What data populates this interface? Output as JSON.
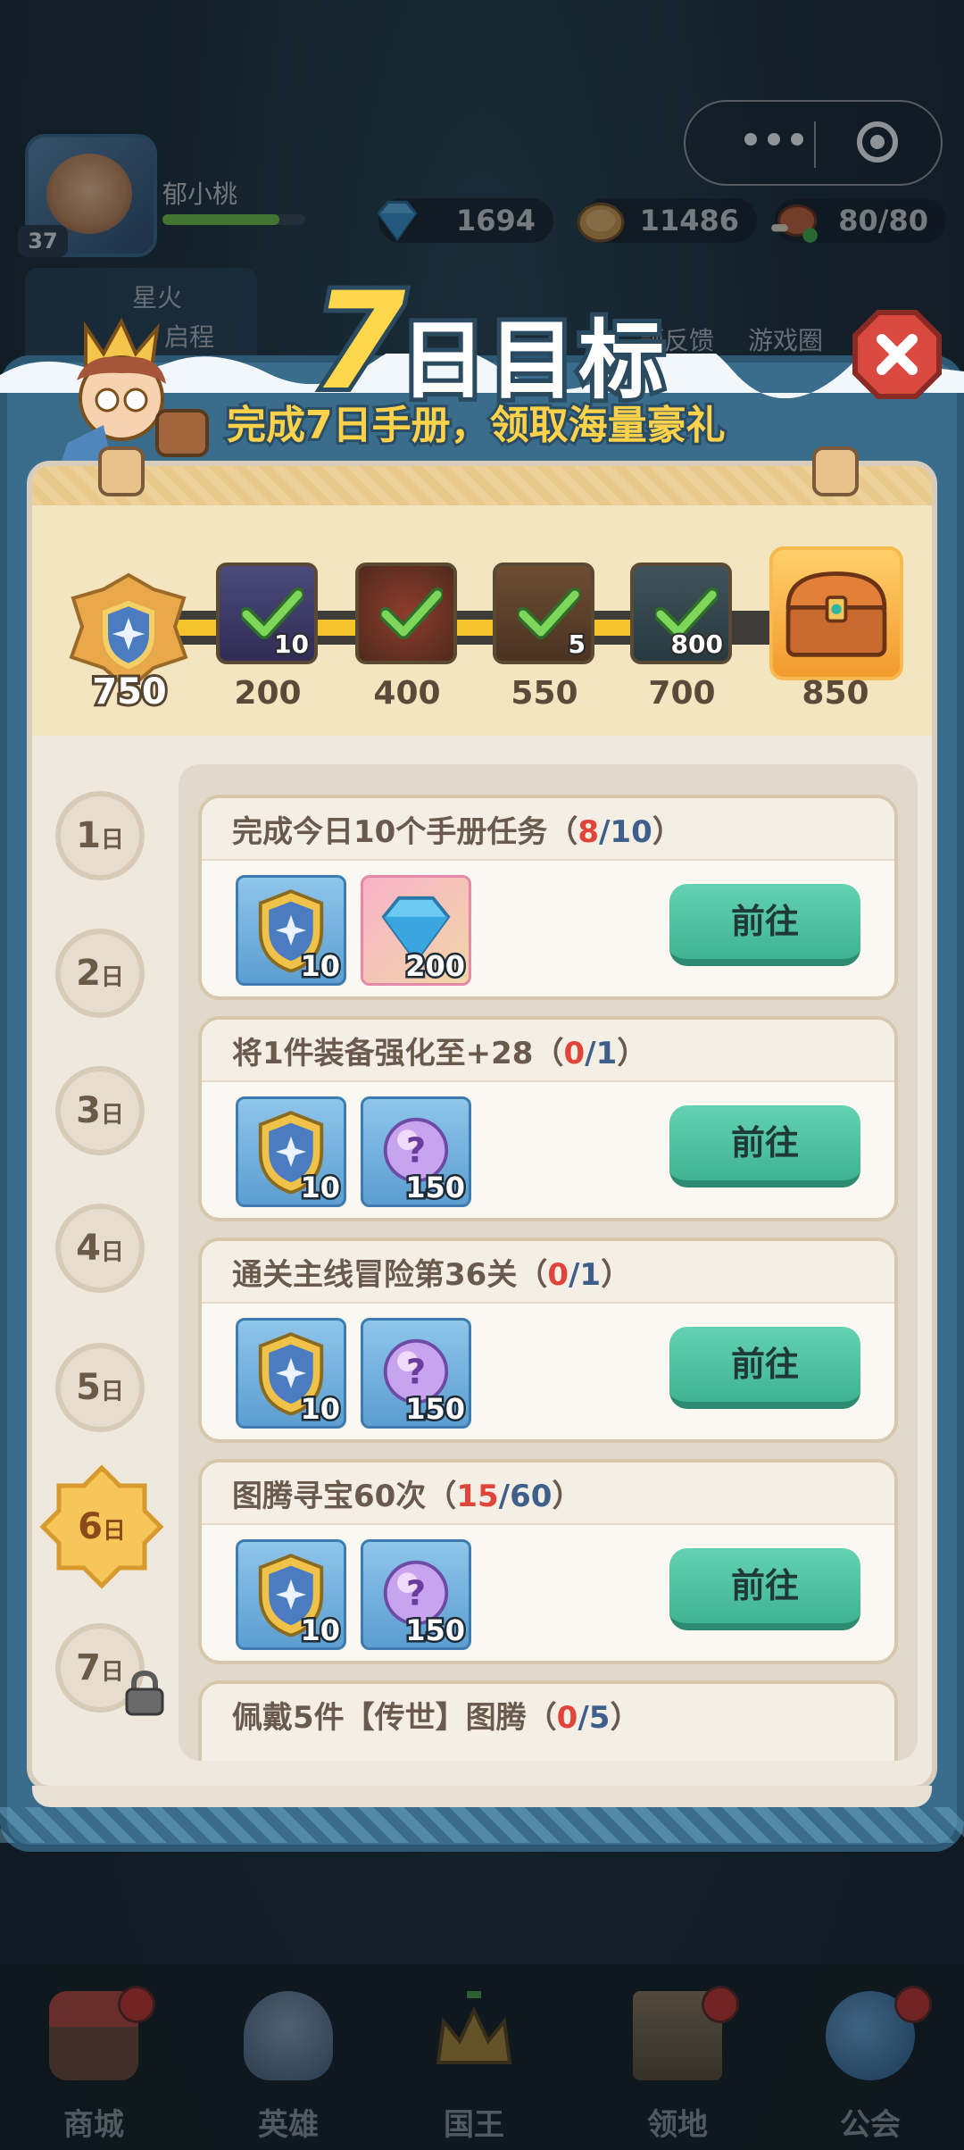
{
  "hud": {
    "player_name": "郁小桃",
    "level": "37",
    "xp_fraction": 0.82,
    "resources": [
      {
        "name": "diamond",
        "icon": "diamond-icon",
        "value": "1694"
      },
      {
        "name": "coin",
        "icon": "coin-icon",
        "value": "11486"
      },
      {
        "name": "stamina",
        "icon": "meat-icon",
        "value": "80/80"
      }
    ],
    "behind_buttons": [
      "星火",
      "启程",
      "题反馈",
      "游戏圈"
    ]
  },
  "modal": {
    "title_number": "7",
    "title_text": "日目标",
    "subtitle": "完成7日手册，领取海量豪礼",
    "points": "750",
    "progress_fraction": 0.78,
    "milestones": [
      {
        "threshold": "200",
        "count": "10",
        "icon": "book-icon",
        "claimed": true
      },
      {
        "threshold": "400",
        "count": "",
        "icon": "shield-orb-icon",
        "claimed": true
      },
      {
        "threshold": "550",
        "count": "5",
        "icon": "hammer-icon",
        "claimed": true
      },
      {
        "threshold": "700",
        "count": "800",
        "icon": "gem-icon",
        "claimed": true
      },
      {
        "threshold": "850",
        "count": "",
        "icon": "treasure-chest-icon",
        "claimed": false
      }
    ],
    "days": [
      {
        "num": "1",
        "suffix": "日"
      },
      {
        "num": "2",
        "suffix": "日"
      },
      {
        "num": "3",
        "suffix": "日"
      },
      {
        "num": "4",
        "suffix": "日"
      },
      {
        "num": "5",
        "suffix": "日"
      },
      {
        "num": "6",
        "suffix": "日"
      },
      {
        "num": "7",
        "suffix": "日"
      }
    ],
    "active_day_index": 5,
    "tasks": [
      {
        "title": "完成今日10个手册任务（",
        "progress": "8",
        "sep": "/",
        "total": "10",
        "close": "）",
        "rewards": [
          {
            "icon": "shield-token-icon",
            "count": "10"
          },
          {
            "icon": "diamond-icon",
            "count": "200"
          }
        ],
        "button": "前往"
      },
      {
        "title": "将1件装备强化至+28（",
        "progress": "0",
        "sep": "/",
        "total": "1",
        "close": "）",
        "rewards": [
          {
            "icon": "shield-token-icon",
            "count": "10"
          },
          {
            "icon": "mystery-orb-icon",
            "count": "150"
          }
        ],
        "button": "前往"
      },
      {
        "title": "通关主线冒险第36关（",
        "progress": "0",
        "sep": "/",
        "total": "1",
        "close": "）",
        "rewards": [
          {
            "icon": "shield-token-icon",
            "count": "10"
          },
          {
            "icon": "mystery-orb-icon",
            "count": "150"
          }
        ],
        "button": "前往"
      },
      {
        "title": "图腾寻宝60次（",
        "progress": "15",
        "sep": "/",
        "total": "60",
        "close": "）",
        "rewards": [
          {
            "icon": "shield-token-icon",
            "count": "10"
          },
          {
            "icon": "mystery-orb-icon",
            "count": "150"
          }
        ],
        "button": "前往"
      },
      {
        "title": "佩戴5件【传世】图腾（",
        "progress": "0",
        "sep": "/",
        "total": "5",
        "close": "）",
        "rewards": [],
        "button": ""
      }
    ]
  },
  "bottom_nav": [
    {
      "label": "商城",
      "icon": "shop-icon",
      "dot": true
    },
    {
      "label": "英雄",
      "icon": "helmet-icon",
      "dot": false
    },
    {
      "label": "国王",
      "icon": "crown-icon",
      "dot": false
    },
    {
      "label": "领地",
      "icon": "castle-icon",
      "dot": true
    },
    {
      "label": "公会",
      "icon": "planet-icon",
      "dot": true
    }
  ],
  "colors": {
    "accent_gold": "#ffd74a",
    "button_green": "#4fc3a1",
    "progress_red": "#e0443a",
    "frame_blue": "#3a6d8c"
  }
}
